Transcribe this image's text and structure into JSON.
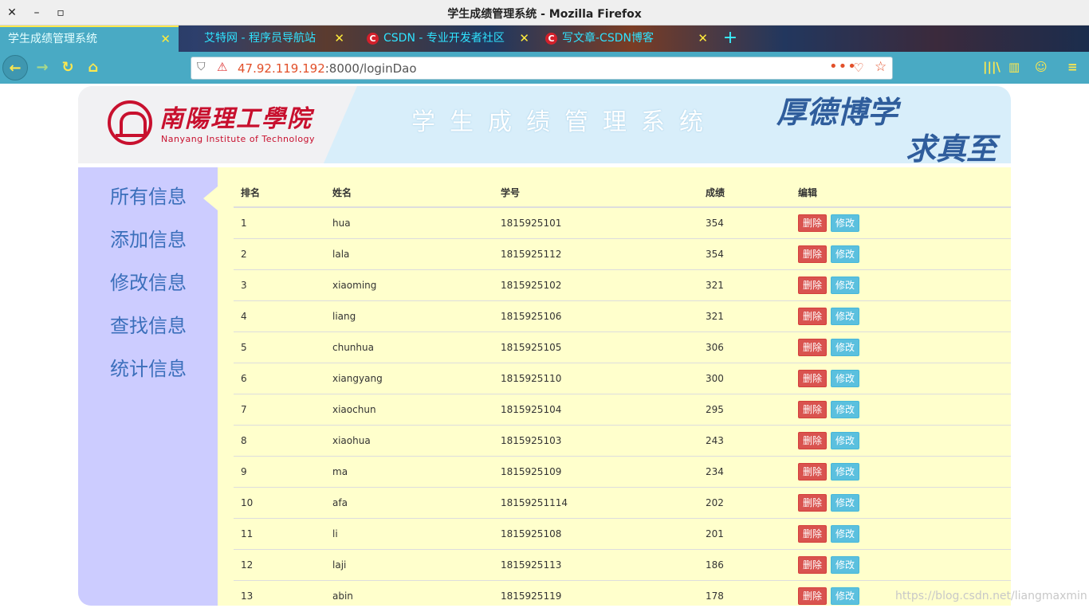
{
  "window": {
    "title": "学生成绩管理系统 - Mozilla Firefox",
    "close_glyph": "✕",
    "minimize_glyph": "–",
    "maximize_glyph": "▫"
  },
  "tabs": [
    {
      "label": "学生成绩管理系统",
      "active": true
    },
    {
      "label": "艾特网 - 程序员导航站",
      "active": false
    },
    {
      "label": "CSDN - 专业开发者社区",
      "active": false,
      "favicon": "C"
    },
    {
      "label": "写文章-CSDN博客",
      "active": false,
      "favicon": "C"
    }
  ],
  "tab_close_glyph": "✕",
  "new_tab_glyph": "+",
  "nav": {
    "back_icon": "←",
    "forward_icon": "→",
    "reload_icon": "↻",
    "home_icon": "⌂",
    "url_host": "47.92.119.192",
    "url_path": ":8000/loginDao",
    "more_icon": "•••",
    "pocket_icon": "♡",
    "star_icon": "☆",
    "library_icon": "|||\\",
    "sidebar_icon": "▥",
    "account_icon": "☺",
    "menu_icon": "≡"
  },
  "banner": {
    "school_cn": "南陽理工學院",
    "school_en": "Nanyang Institute of Technology",
    "system_title": "学生成绩管理系统",
    "motto_1": "厚德博学",
    "motto_2": "求真至善"
  },
  "sidebar": {
    "items": [
      "所有信息",
      "添加信息",
      "修改信息",
      "查找信息",
      "统计信息"
    ],
    "active_index": 0
  },
  "table": {
    "headers": [
      "排名",
      "姓名",
      "学号",
      "成绩",
      "编辑"
    ],
    "delete_label": "删除",
    "edit_label": "修改",
    "rows": [
      [
        "1",
        "hua",
        "1815925101",
        "354"
      ],
      [
        "2",
        "lala",
        "1815925112",
        "354"
      ],
      [
        "3",
        "xiaoming",
        "1815925102",
        "321"
      ],
      [
        "4",
        "liang",
        "1815925106",
        "321"
      ],
      [
        "5",
        "chunhua",
        "1815925105",
        "306"
      ],
      [
        "6",
        "xiangyang",
        "1815925110",
        "300"
      ],
      [
        "7",
        "xiaochun",
        "1815925104",
        "295"
      ],
      [
        "8",
        "xiaohua",
        "1815925103",
        "243"
      ],
      [
        "9",
        "ma",
        "1815925109",
        "234"
      ],
      [
        "10",
        "afa",
        "18159251114",
        "202"
      ],
      [
        "11",
        "li",
        "1815925108",
        "201"
      ],
      [
        "12",
        "laji",
        "1815925113",
        "186"
      ],
      [
        "13",
        "abin",
        "1815925119",
        "178"
      ]
    ]
  },
  "watermark": "https://blog.csdn.net/liangmaxmin",
  "colors": {
    "accent_toolbar": "#49aac4",
    "sidebar_bg": "#ccccff",
    "table_bg": "#ffffcc",
    "delete_button": "#d9534f",
    "edit_button": "#5bc0de"
  }
}
